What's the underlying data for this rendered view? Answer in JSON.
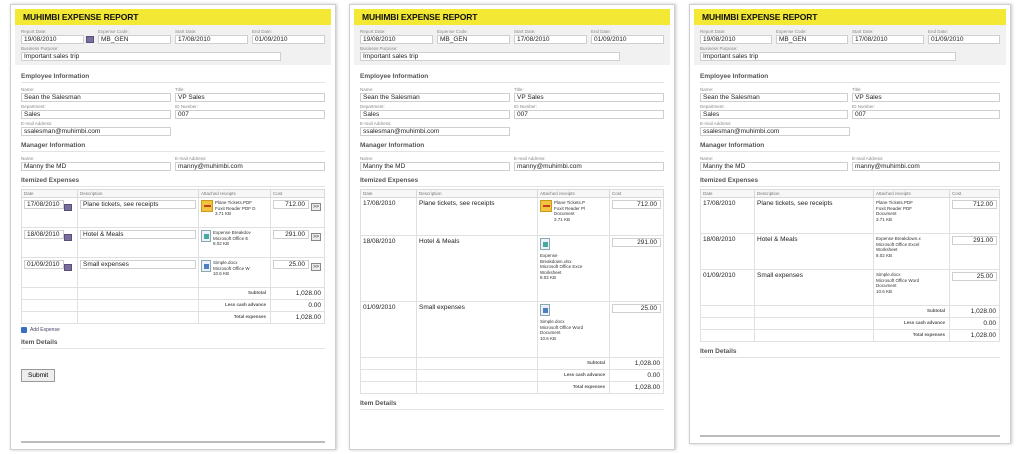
{
  "title": "MUHIMBI EXPENSE REPORT",
  "labels": {
    "report_date": "Report Date:",
    "expense_code": "Expense Code:",
    "start_date": "Start Date:",
    "end_date": "End Date:",
    "business_purpose": "Business Purpose:",
    "name": "Name:",
    "title": "Title:",
    "department": "Department:",
    "id_number": "ID Number:",
    "email": "E-mail Address:",
    "employee_section": "Employee Information",
    "manager_section": "Manager Information",
    "itemized_section": "Itemized Expenses",
    "item_details": "Item Details",
    "col_date": "Date",
    "col_description": "Description",
    "col_receipts": "Attached receipts",
    "col_cost": "Cost",
    "subtotal": "Subtotal",
    "less_cash": "Less cash advance",
    "total": "Total expenses",
    "add_expense": "Add Expense",
    "submit": "Submit"
  },
  "report": {
    "report_date": "19/08/2010",
    "expense_code": "MB_GEN",
    "start_date": "17/08/2010",
    "end_date": "01/09/2010",
    "business_purpose": "Important sales trip"
  },
  "employee": {
    "name": "Sean the Salesman",
    "title": "VP Sales",
    "department": "Sales",
    "id_number": "007",
    "email": "ssalesman@muhimbi.com"
  },
  "manager": {
    "name": "Manny the MD",
    "email": "manny@muhimbi.com"
  },
  "expenses": [
    {
      "date": "17/08/2010",
      "description": "Plane tickets, see receipts",
      "cost": "712.00",
      "receipt_short": [
        "Plane Tickets.PDF",
        "Foxit Reader PDF D",
        "3.71 KB"
      ],
      "receipt_mid": [
        "Plane Tickets.P",
        "Foxit Reader Pl",
        "Document",
        "3.71 KB"
      ],
      "receipt_full": [
        "Plane Tickets.PDF",
        "Foxit Reader PDF",
        "Document",
        "3.71 KB"
      ]
    },
    {
      "date": "18/08/2010",
      "description": "Hotel & Meals",
      "cost": "291.00",
      "receipt_short": [
        "Expense Breakdov",
        "Microsoft Office E",
        "8.02 KB"
      ],
      "receipt_mid": [
        "Expense",
        "Breakdown.xlsx",
        "Microsoft Office Exce",
        "Worksheet",
        "8.02 KB"
      ],
      "receipt_full": [
        "Expense Breakdown.x",
        "Microsoft Office Excel",
        "Worksheet",
        "8.02 KB"
      ]
    },
    {
      "date": "01/09/2010",
      "description": "Small expenses",
      "cost": "25.00",
      "receipt_short": [
        "Simple.docx",
        "Microsoft Office W",
        "10.6 KB"
      ],
      "receipt_mid": [
        "Simple.docx",
        "Microsoft Office Word",
        "Document",
        "10.6 KB"
      ],
      "receipt_full": [
        "Simple.docx",
        "Microsoft Office Word",
        "Document",
        "10.6 KB"
      ]
    }
  ],
  "totals": {
    "subtotal": "1,028.00",
    "less_cash": "0.00",
    "total": "1,028.00"
  },
  "icons": {
    "calendar": "calendar-icon",
    "pdf": "pdf-icon",
    "excel": "excel-icon",
    "word": "word-icon",
    "more": "more-arrows-icon",
    "add": "add-icon"
  },
  "colors": {
    "header": "#f3e834"
  }
}
